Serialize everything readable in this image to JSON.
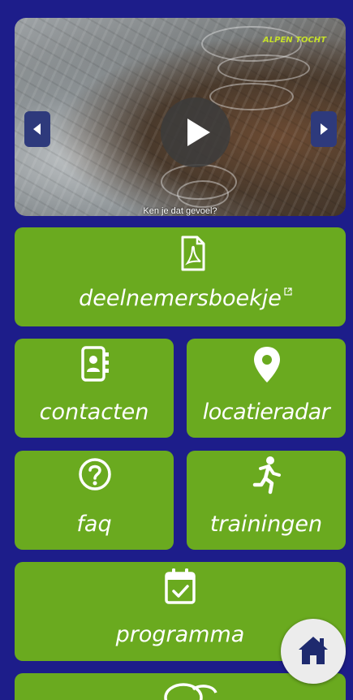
{
  "video": {
    "caption": "Ken je dat gevoel?",
    "brand": "ALPEN TOCHT",
    "icons": {
      "play": "play-icon",
      "prev": "chevron-left-icon",
      "next": "chevron-right-icon"
    }
  },
  "tiles": {
    "booklet": {
      "label": "deelnemersboekje",
      "icon": "pdf-file-icon",
      "external": "external-link-icon"
    },
    "contacts": {
      "label": "contacten",
      "icon": "address-book-icon"
    },
    "location": {
      "label": "locatieradar",
      "icon": "map-pin-icon"
    },
    "faq": {
      "label": "faq",
      "icon": "question-circle-icon"
    },
    "training": {
      "label": "trainingen",
      "icon": "running-icon"
    },
    "program": {
      "label": "programma",
      "icon": "calendar-check-icon"
    },
    "chat": {
      "icon": "chat-icon"
    }
  },
  "home": {
    "icon": "home-icon"
  },
  "colors": {
    "background": "#1d1d8a",
    "tile": "#6aaa1f",
    "text": "#ffffff",
    "home_icon": "#1e2a6e"
  }
}
